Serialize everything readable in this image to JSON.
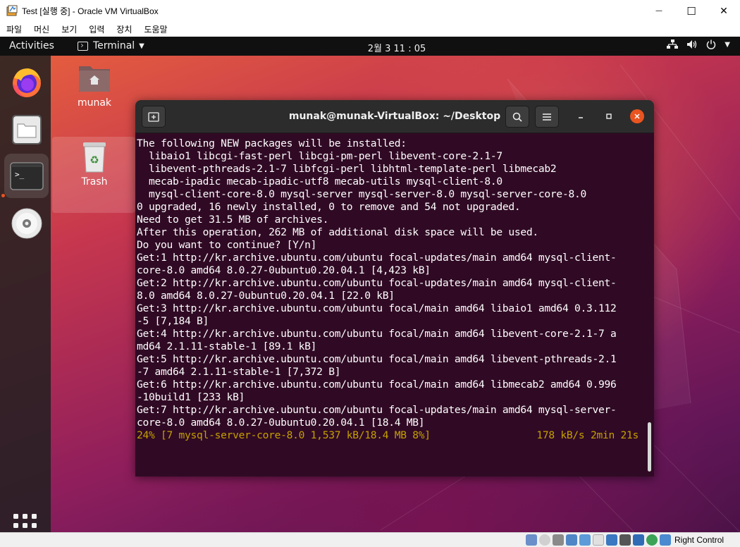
{
  "window": {
    "title": "Test [실행 중] - Oracle VM VirtualBox",
    "minimize_glyph": "—",
    "maximize_glyph": "☐",
    "close_glyph": "✕"
  },
  "menubar": [
    "파일",
    "머신",
    "보기",
    "입력",
    "장치",
    "도움말"
  ],
  "topbar": {
    "activities": "Activities",
    "app_name": "Terminal",
    "clock": "2월 3  11 : 05"
  },
  "dock": {
    "items": [
      "firefox-icon",
      "files-icon",
      "terminal-icon",
      "dvd-icon"
    ],
    "show_apps": "grid-icon"
  },
  "desktop": {
    "home_label": "munak",
    "trash_label": "Trash"
  },
  "terminal": {
    "title": "munak@munak-VirtualBox: ~/Desktop",
    "lines": [
      "The following NEW packages will be installed:",
      "  libaio1 libcgi-fast-perl libcgi-pm-perl libevent-core-2.1-7",
      "  libevent-pthreads-2.1-7 libfcgi-perl libhtml-template-perl libmecab2",
      "  mecab-ipadic mecab-ipadic-utf8 mecab-utils mysql-client-8.0",
      "  mysql-client-core-8.0 mysql-server mysql-server-8.0 mysql-server-core-8.0",
      "0 upgraded, 16 newly installed, 0 to remove and 54 not upgraded.",
      "Need to get 31.5 MB of archives.",
      "After this operation, 262 MB of additional disk space will be used.",
      "Do you want to continue? [Y/n]",
      "Get:1 http://kr.archive.ubuntu.com/ubuntu focal-updates/main amd64 mysql-client-",
      "core-8.0 amd64 8.0.27-0ubuntu0.20.04.1 [4,423 kB]",
      "Get:2 http://kr.archive.ubuntu.com/ubuntu focal-updates/main amd64 mysql-client-",
      "8.0 amd64 8.0.27-0ubuntu0.20.04.1 [22.0 kB]",
      "Get:3 http://kr.archive.ubuntu.com/ubuntu focal/main amd64 libaio1 amd64 0.3.112",
      "-5 [7,184 B]",
      "Get:4 http://kr.archive.ubuntu.com/ubuntu focal/main amd64 libevent-core-2.1-7 a",
      "md64 2.1.11-stable-1 [89.1 kB]",
      "Get:5 http://kr.archive.ubuntu.com/ubuntu focal/main amd64 libevent-pthreads-2.1",
      "-7 amd64 2.1.11-stable-1 [7,372 B]",
      "Get:6 http://kr.archive.ubuntu.com/ubuntu focal/main amd64 libmecab2 amd64 0.996",
      "-10build1 [233 kB]",
      "Get:7 http://kr.archive.ubuntu.com/ubuntu focal-updates/main amd64 mysql-server-",
      "core-8.0 amd64 8.0.27-0ubuntu0.20.04.1 [18.4 MB]"
    ],
    "progress_left": "24% [7 mysql-server-core-8.0 1,537 kB/18.4 MB 8%]",
    "progress_right": "178 kB/s 2min 21s",
    "progress_color": "#c4a000",
    "background_color": "#300a24"
  },
  "statusbar": {
    "host_key": "Right Control"
  }
}
